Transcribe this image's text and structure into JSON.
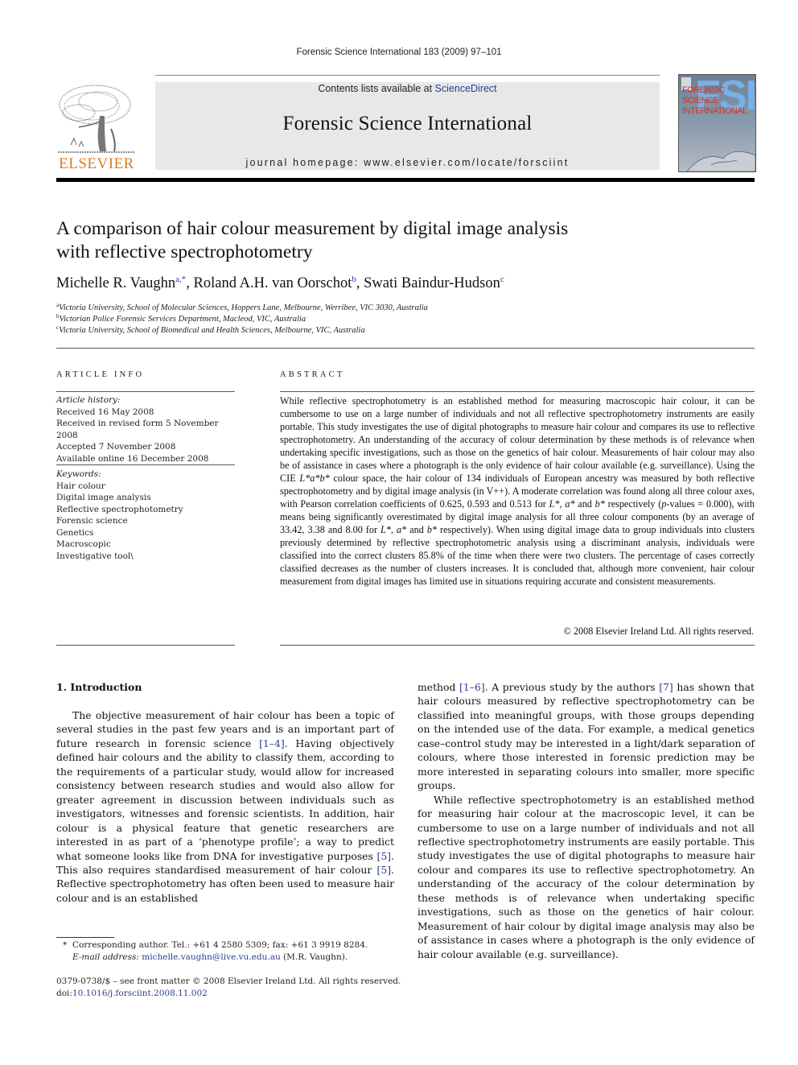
{
  "running_head": "Forensic Science International 183 (2009) 97–101",
  "masthead": {
    "contents_prefix": "Contents lists available at ",
    "contents_link": "ScienceDirect",
    "journal_name": "Forensic Science International",
    "homepage": "journal homepage: www.elsevier.com/locate/forsciint",
    "publisher_logo_text": "ELSEVIER",
    "publisher_color": "#e07a20",
    "cover": {
      "big_letters": "FSI",
      "lines": [
        "FORENSIC",
        "SCIENCE",
        "INTERNATIONAL"
      ]
    }
  },
  "article": {
    "title_line1": "A comparison of hair colour measurement by digital image analysis",
    "title_line2": "with reflective spectrophotometry",
    "authors": [
      {
        "name": "Michelle R. Vaughn",
        "sup": "a,*",
        "sep": ", "
      },
      {
        "name": "Roland A.H. van Oorschot",
        "sup": "b",
        "sep": ", "
      },
      {
        "name": "Swati Baindur-Hudson",
        "sup": "c",
        "sep": ""
      }
    ],
    "affiliations": [
      {
        "mark": "a",
        "text": "Victoria University, School of Molecular Sciences, Hoppers Lane, Melbourne, Werribee, VIC 3030, Australia"
      },
      {
        "mark": "b",
        "text": "Victorian Police Forensic Services Department, Macleod, VIC, Australia"
      },
      {
        "mark": "c",
        "text": "Victoria University, School of Biomedical and Health Sciences, Melbourne, VIC, Australia"
      }
    ]
  },
  "article_info": {
    "heading": "ARTICLE INFO",
    "history_label": "Article history:",
    "history": [
      "Received 16 May 2008",
      "Received in revised form 5 November 2008",
      "Accepted 7 November 2008",
      "Available online 16 December 2008"
    ],
    "keywords_label": "Keywords:",
    "keywords": [
      "Hair colour",
      "Digital image analysis",
      "Reflective spectrophotometry",
      "Forensic science",
      "Genetics",
      "Macroscopic",
      "Investigative tool\\"
    ]
  },
  "abstract": {
    "heading": "ABSTRACT",
    "p1": "While reflective spectrophotometry is an established method for measuring macroscopic hair colour, it can be cumbersome to use on a large number of individuals and not all reflective spectrophotometry instruments are easily portable. This study investigates the use of digital photographs to measure hair colour and compares its use to reflective spectrophotometry. An understanding of the accuracy of colour determination by these methods is of relevance when undertaking specific investigations, such as those on the genetics of hair colour. Measurements of hair colour may also be of assistance in cases where a photograph is the only evidence of hair colour available (e.g. surveillance). Using the CIE ",
    "lab": "L*a*b*",
    "p2": " colour space, the hair colour of 134 individuals of European ancestry was measured by both reflective spectrophotometry and by digital image analysis (in V++). A moderate correlation was found along all three colour axes, with Pearson correlation coefficients of 0.625, 0.593 and 0.513 for ",
    "l": "L*",
    "a": "a*",
    "b": "b*",
    "and": " and ",
    "comma": ", ",
    "p3a": " respectively (",
    "p_italic": "p",
    "p3b": "-values = 0.000), with means being significantly overestimated by digital image analysis for all three colour components (by an average of 33.42, 3.38 and 8.00 for ",
    "p4": " respectively). When using digital image data to group individuals into clusters previously determined by reflective spectrophotometric analysis using a discriminant analysis, individuals were classified into the correct clusters 85.8% of the time when there were two clusters. The percentage of cases correctly classified decreases as the number of clusters increases. It is concluded that, although more convenient, hair colour measurement from digital images has limited use in situations requiring accurate and consistent measurements.",
    "copyright": "© 2008 Elsevier Ireland Ltd. All rights reserved."
  },
  "introduction": {
    "heading": "1. Introduction",
    "left": {
      "t1": "The objective measurement of hair colour has been a topic of several studies in the past few years and is an important part of future research in forensic science ",
      "r1": "[1–4]",
      "t2": ". Having objectively defined hair colours and the ability to classify them, according to the requirements of a particular study, would allow for increased consistency between research studies and would also allow for greater agreement in discussion between individuals such as investigators, witnesses and forensic scientists. In addition, hair colour is a physical feature that genetic researchers are interested in as part of a ‘phenotype profile’; a way to predict what someone looks like from DNA for investigative purposes ",
      "r2": "[5]",
      "t3": ". This also requires standardised measurement of hair colour ",
      "r3": "[5]",
      "t4": ". Reflective spectrophotometry has often been used to measure hair colour and is an established"
    },
    "right": {
      "t1": "method ",
      "r1": "[1–6]",
      "t2": ". A previous study by the authors ",
      "r2": "[7]",
      "t3": " has shown that hair colours measured by reflective spectrophotometry can be classified into meaningful groups, with those groups depending on the intended use of the data. For example, a medical genetics case–control study may be interested in a light/dark separation of colours, where those interested in forensic prediction may be more interested in separating colours into smaller, more specific groups.",
      "p2": "While reflective spectrophotometry is an established method for measuring hair colour at the macroscopic level, it can be cumbersome to use on a large number of individuals and not all reflective spectrophotometry instruments are easily portable. This study investigates the use of digital photographs to measure hair colour and compares its use to reflective spectrophotometry. An understanding of the accuracy of the colour determination by these methods is of relevance when undertaking specific investigations, such as those on the genetics of hair colour. Measurement of hair colour by digital image analysis may also be of assistance in cases where a photograph is the only evidence of hair colour available (e.g. surveillance)."
    }
  },
  "footnotes": {
    "star": "*",
    "corresponding": "Corresponding author. Tel.: +61 4 2580 5309; fax: +61 3 9919 8284.",
    "email_label": "E-mail address:",
    "email": "michelle.vaughn@live.vu.edu.au",
    "email_suffix": " (M.R. Vaughn).",
    "front_matter": "0379-0738/$ – see front matter © 2008 Elsevier Ireland Ltd. All rights reserved.",
    "doi_prefix": "doi:",
    "doi": "10.1016/j.forsciint.2008.11.002"
  },
  "colors": {
    "link": "#2b3d8f",
    "masthead_bg": "#e8e8e8"
  }
}
